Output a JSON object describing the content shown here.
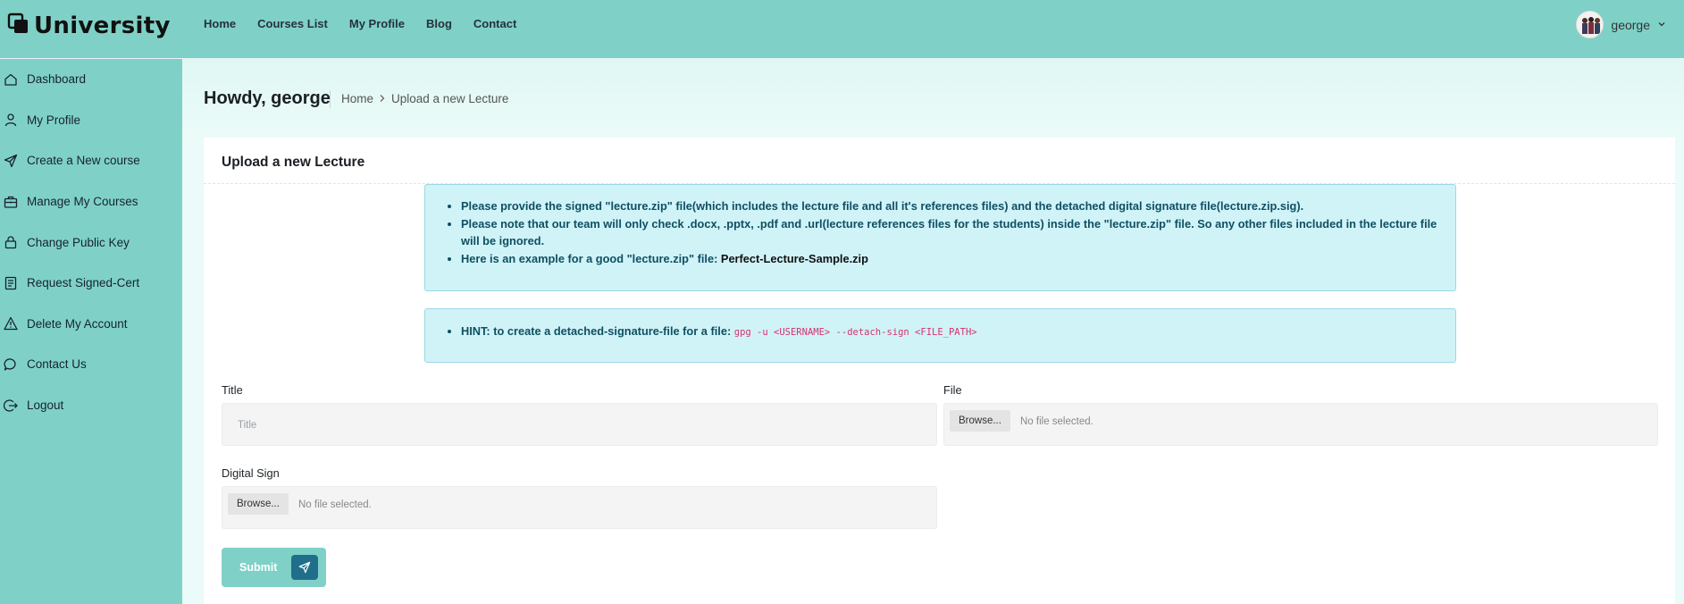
{
  "brand": {
    "name": "University",
    "logo_icon": "logo-squares-icon"
  },
  "topnav": {
    "items": [
      {
        "label": "Home"
      },
      {
        "label": "Courses List"
      },
      {
        "label": "My Profile"
      },
      {
        "label": "Blog"
      },
      {
        "label": "Contact"
      }
    ]
  },
  "user": {
    "name": "george",
    "dropdown_icon": "chevron-down-icon"
  },
  "sidebar": {
    "items": [
      {
        "label": "Dashboard",
        "icon": "home-icon"
      },
      {
        "label": "My Profile",
        "icon": "user-icon"
      },
      {
        "label": "Create a New course",
        "icon": "send-icon"
      },
      {
        "label": "Manage My Courses",
        "icon": "briefcase-icon"
      },
      {
        "label": "Change Public Key",
        "icon": "lock-icon"
      },
      {
        "label": "Request Signed-Cert",
        "icon": "document-icon"
      },
      {
        "label": "Delete My Account",
        "icon": "warning-icon"
      },
      {
        "label": "Contact Us",
        "icon": "chat-icon"
      },
      {
        "label": "Logout",
        "icon": "logout-icon"
      }
    ]
  },
  "header": {
    "greeting": "Howdy, george",
    "breadcrumb": {
      "home": "Home",
      "current": "Upload a new Lecture"
    }
  },
  "card": {
    "title": "Upload a new Lecture",
    "info": {
      "items": [
        "Please provide the signed \"lecture.zip\" file(which includes the lecture file and all it's references files) and the detached digital signature file(lecture.zip.sig).",
        "Please note that our team will only check .docx, .pptx, .pdf and .url(lecture references files for the students) inside the \"lecture.zip\" file. So any other files included in the lecture file will be ignored.",
        "Here is an example for a good \"lecture.zip\" file: "
      ],
      "example_link": "Perfect-Lecture-Sample.zip"
    },
    "hint": {
      "text": "HINT: to create a detached-signature-file for a file: ",
      "command": "gpg -u <USERNAME> --detach-sign <FILE_PATH>"
    },
    "form": {
      "title_label": "Title",
      "title_placeholder": "Title",
      "file_label": "File",
      "file_browse": "Browse...",
      "file_status": "No file selected.",
      "sign_label": "Digital Sign",
      "sign_browse": "Browse...",
      "sign_status": "No file selected.",
      "submit_label": "Submit"
    }
  },
  "colors": {
    "primary": "#7fd1c7",
    "accent": "#1f6f8b",
    "alert_bg": "#d0f3f8"
  }
}
